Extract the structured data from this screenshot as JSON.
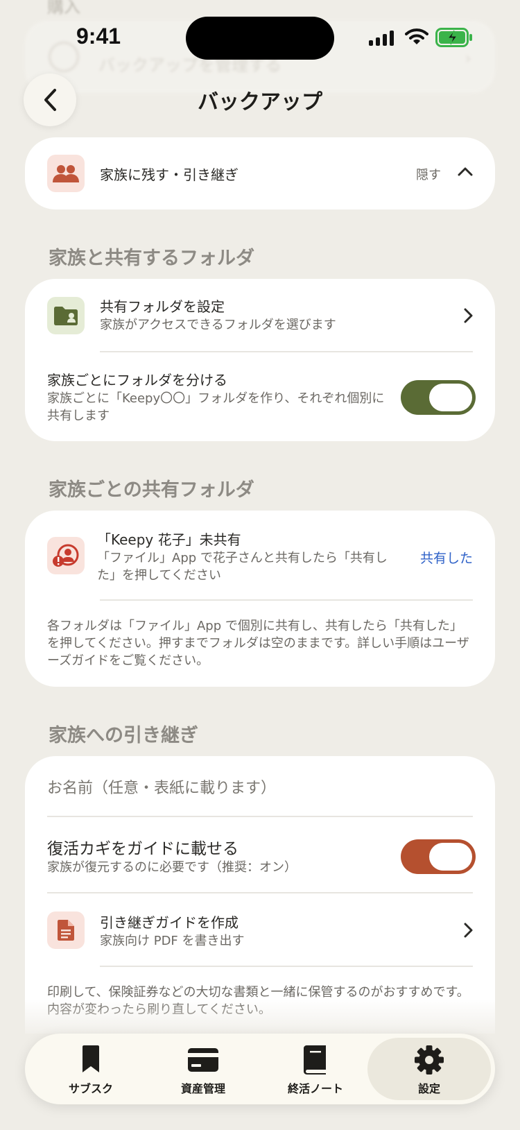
{
  "status_bar": {
    "time": "9:41"
  },
  "ghost": {
    "top_text": "購入",
    "row_text": "バックアップを管理する"
  },
  "nav": {
    "title": "バックアップ"
  },
  "family_header": {
    "label": "家族に残す・引き継ぎ",
    "action": "隠す",
    "icon": "people-icon"
  },
  "shared_folder": {
    "section_title": "家族と共有するフォルダ",
    "setup": {
      "title": "共有フォルダを設定",
      "subtitle": "家族がアクセスできるフォルダを選びます",
      "icon": "folder-person-icon"
    },
    "split": {
      "title": "家族ごとにフォルダを分ける",
      "subtitle": "家族ごとに「Keepy〇〇」フォルダを作り、それぞれ個別に共有します",
      "toggle_on": true,
      "toggle_color": "#5a6b35"
    }
  },
  "per_family": {
    "section_title": "家族ごとの共有フォルダ",
    "item": {
      "title": "「Keepy 花子」未共有",
      "subtitle": "「ファイル」App で花子さんと共有したら「共有した」を押してください",
      "action": "共有した",
      "icon": "person-alert-icon"
    },
    "note": "各フォルダは「ファイル」App で個別に共有し、共有したら「共有した」を押してください。押すまでフォルダは空のままです。詳しい手順はユーザーズガイドをご覧ください。"
  },
  "handover": {
    "section_title": "家族への引き継ぎ",
    "name_placeholder": "お名前（任意・表紙に載ります）",
    "recovery": {
      "title": "復活カギをガイドに載せる",
      "subtitle": "家族が復元するのに必要です（推奨：オン）",
      "toggle_on": true,
      "toggle_color": "#b5502f"
    },
    "guide": {
      "title": "引き継ぎガイドを作成",
      "subtitle": "家族向け PDF を書き出す",
      "icon": "document-icon"
    },
    "note": "印刷して、保険証券などの大切な書類と一緒に保管するのがおすすめです。内容が変わったら刷り直してください。"
  },
  "tabs": [
    {
      "label": "サブスク",
      "icon": "bookmark-icon"
    },
    {
      "label": "資産管理",
      "icon": "card-icon"
    },
    {
      "label": "終活ノート",
      "icon": "book-icon"
    },
    {
      "label": "設定",
      "icon": "gear-icon",
      "active": true
    }
  ],
  "colors": {
    "accent_green": "#5a6b35",
    "accent_red": "#b5502f",
    "link_blue": "#2f62c8"
  }
}
